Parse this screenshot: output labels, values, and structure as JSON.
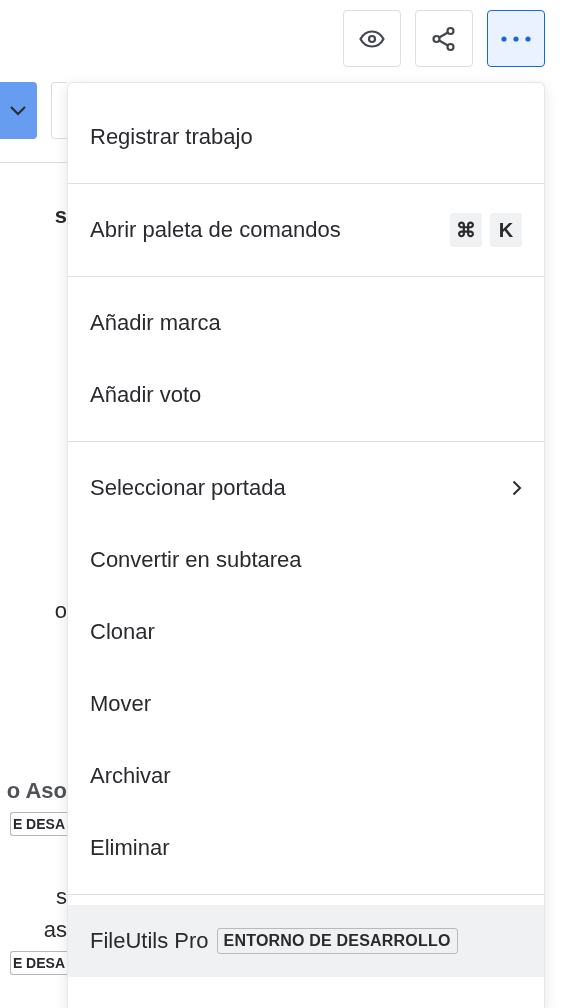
{
  "toolbar": {
    "buttons": [
      {
        "kind": "eye",
        "selected": false
      },
      {
        "kind": "share",
        "selected": false
      },
      {
        "kind": "more",
        "selected": true
      }
    ]
  },
  "background": {
    "texts": [
      {
        "kind": "heading",
        "text": "s"
      },
      {
        "kind": "text",
        "text": "o"
      },
      {
        "kind": "label",
        "text": "o Aso"
      },
      {
        "kind": "badge",
        "text": "E DESA"
      },
      {
        "kind": "text",
        "text": "s"
      },
      {
        "kind": "text",
        "text": "as"
      },
      {
        "kind": "badge",
        "text": "E DESA"
      }
    ]
  },
  "menu": {
    "groups": [
      [
        {
          "kind": "plain",
          "label": "Registrar trabajo",
          "highlighted": false
        }
      ],
      [
        {
          "kind": "shortcut",
          "label": "Abrir paleta de comandos",
          "keys": [
            "⌘",
            "K"
          ],
          "highlighted": false
        }
      ],
      [
        {
          "kind": "plain",
          "label": "Añadir marca",
          "highlighted": false
        },
        {
          "kind": "plain",
          "label": "Añadir voto",
          "highlighted": false
        }
      ],
      [
        {
          "kind": "submenu",
          "label": "Seleccionar portada",
          "highlighted": false
        },
        {
          "kind": "plain",
          "label": "Convertir en subtarea",
          "highlighted": false
        },
        {
          "kind": "plain",
          "label": "Clonar",
          "highlighted": false
        },
        {
          "kind": "plain",
          "label": "Mover",
          "highlighted": false
        },
        {
          "kind": "plain",
          "label": "Archivar",
          "highlighted": false
        },
        {
          "kind": "plain",
          "label": "Eliminar",
          "highlighted": false
        }
      ],
      [
        {
          "kind": "app",
          "label": "FileUtils Pro",
          "badge": "ENTORNO DE DESARROLLO",
          "highlighted": true
        }
      ]
    ]
  }
}
